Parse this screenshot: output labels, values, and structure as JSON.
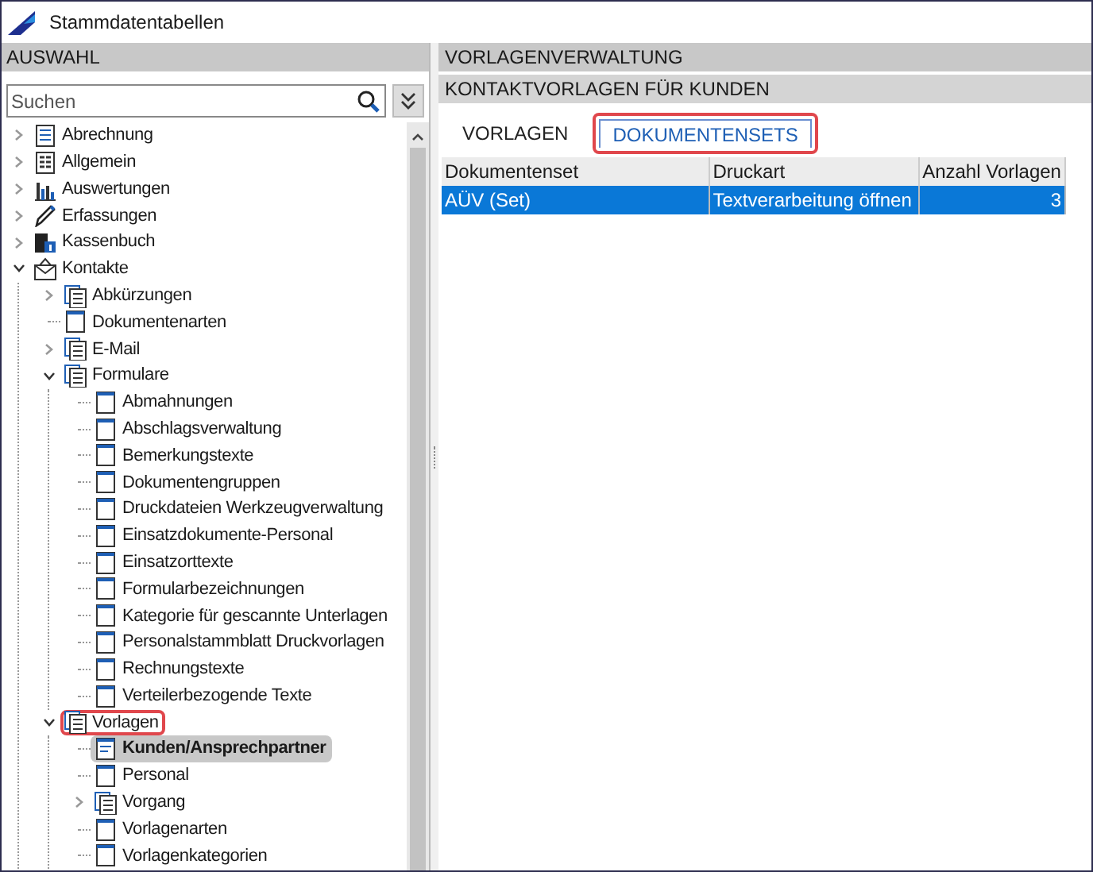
{
  "window": {
    "title": "Stammdatentabellen"
  },
  "left_panel": {
    "header": "AUSWAHL",
    "search": {
      "placeholder": "Suchen"
    },
    "tree": [
      {
        "label": "Abrechnung",
        "kind": "list",
        "expanded": false,
        "selected": false,
        "highlighted": false
      },
      {
        "label": "Allgemein",
        "kind": "grid",
        "expanded": false,
        "selected": false,
        "highlighted": false
      },
      {
        "label": "Auswertungen",
        "kind": "chart",
        "expanded": false,
        "selected": false,
        "highlighted": false
      },
      {
        "label": "Erfassungen",
        "kind": "pen",
        "expanded": false,
        "selected": false,
        "highlighted": false
      },
      {
        "label": "Kassenbuch",
        "kind": "cash",
        "expanded": false,
        "selected": false,
        "highlighted": false
      },
      {
        "label": "Kontakte",
        "kind": "mail",
        "expanded": true,
        "selected": false,
        "highlighted": false,
        "children": [
          {
            "label": "Abkürzungen",
            "kind": "docs",
            "expanded": false,
            "selected": false,
            "highlighted": false
          },
          {
            "label": "Dokumentenarten",
            "kind": "page",
            "selected": false,
            "highlighted": false
          },
          {
            "label": "E-Mail",
            "kind": "docs",
            "expanded": false,
            "selected": false,
            "highlighted": false
          },
          {
            "label": "Formulare",
            "kind": "docs",
            "expanded": true,
            "selected": false,
            "highlighted": false,
            "children": [
              {
                "label": "Abmahnungen",
                "kind": "page",
                "selected": false,
                "highlighted": false
              },
              {
                "label": "Abschlagsverwaltung",
                "kind": "page",
                "selected": false,
                "highlighted": false
              },
              {
                "label": "Bemerkungstexte",
                "kind": "page",
                "selected": false,
                "highlighted": false
              },
              {
                "label": "Dokumentengruppen",
                "kind": "page",
                "selected": false,
                "highlighted": false
              },
              {
                "label": "Druckdateien Werkzeugverwaltung",
                "kind": "page",
                "selected": false,
                "highlighted": false
              },
              {
                "label": "Einsatzdokumente-Personal",
                "kind": "page",
                "selected": false,
                "highlighted": false
              },
              {
                "label": "Einsatzorttexte",
                "kind": "page",
                "selected": false,
                "highlighted": false
              },
              {
                "label": "Formularbezeichnungen",
                "kind": "page",
                "selected": false,
                "highlighted": false
              },
              {
                "label": "Kategorie für gescannte Unterlagen",
                "kind": "page",
                "selected": false,
                "highlighted": false
              },
              {
                "label": "Personalstammblatt Druckvorlagen",
                "kind": "page",
                "selected": false,
                "highlighted": false
              },
              {
                "label": "Rechnungstexte",
                "kind": "page",
                "selected": false,
                "highlighted": false
              },
              {
                "label": "Verteilerbezogende Texte",
                "kind": "page",
                "selected": false,
                "highlighted": false
              }
            ]
          },
          {
            "label": "Vorlagen",
            "kind": "docs",
            "expanded": true,
            "selected": false,
            "highlighted": true,
            "children": [
              {
                "label": "Kunden/Ansprechpartner",
                "kind": "form",
                "selected": true,
                "highlighted": false
              },
              {
                "label": "Personal",
                "kind": "page",
                "selected": false,
                "highlighted": false
              },
              {
                "label": "Vorgang",
                "kind": "docs",
                "expanded": false,
                "selected": false,
                "highlighted": false
              },
              {
                "label": "Vorlagenarten",
                "kind": "page",
                "selected": false,
                "highlighted": false
              },
              {
                "label": "Vorlagenkategorien",
                "kind": "page",
                "selected": false,
                "highlighted": false
              }
            ]
          }
        ]
      }
    ]
  },
  "right_panel": {
    "header": "VORLAGENVERWALTUNG",
    "subheader": "KONTAKTVORLAGEN FÜR KUNDEN",
    "tabs": [
      {
        "label": "VORLAGEN",
        "selected": false,
        "highlighted": false
      },
      {
        "label": "DOKUMENTENSETS",
        "selected": true,
        "highlighted": true
      }
    ],
    "table": {
      "columns": [
        "Dokumentenset",
        "Druckart",
        "Anzahl Vorlagen"
      ],
      "rows": [
        {
          "cells": [
            "AÜV (Set)",
            "Textverarbeitung öffnen",
            "3"
          ],
          "selected": true
        }
      ]
    }
  }
}
